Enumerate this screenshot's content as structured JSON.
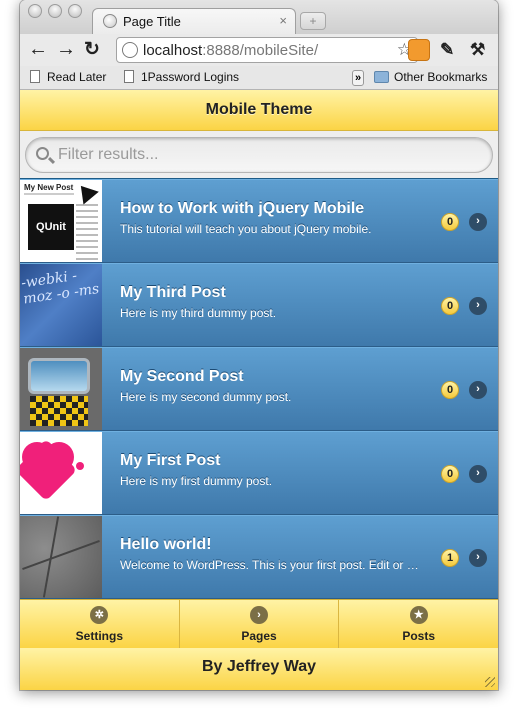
{
  "browser": {
    "tab_title": "Page Title",
    "tab_close": "×",
    "new_tab": "+",
    "url_host": "localhost",
    "url_rest": ":8888/mobileSite/",
    "bookmarks": [
      "Read Later",
      "1Password Logins"
    ],
    "bookmarks_more": "»",
    "other_bookmarks": "Other Bookmarks"
  },
  "page": {
    "header_title": "Mobile Theme",
    "filter_placeholder": "Filter results...",
    "footer": "By Jeffrey Way"
  },
  "posts": [
    {
      "title": "How to Work with jQuery Mobile",
      "excerpt": "This tutorial will teach you about jQuery mobile.",
      "count": "0",
      "thumb_label": "QUnit"
    },
    {
      "title": "My Third Post",
      "excerpt": "Here is my third dummy post.",
      "count": "0",
      "thumb_label": "-webki -moz -o -ms"
    },
    {
      "title": "My Second Post",
      "excerpt": "Here is my second dummy post.",
      "count": "0",
      "thumb_label": ""
    },
    {
      "title": "My First Post",
      "excerpt": "Here is my first dummy post.",
      "count": "0",
      "thumb_label": ""
    },
    {
      "title": "Hello world!",
      "excerpt": "Welcome to WordPress. This is your first post. Edit or delete it, then start blogging!",
      "count": "1",
      "thumb_label": ""
    }
  ],
  "navbar": [
    {
      "label": "Settings",
      "icon": "gear-icon"
    },
    {
      "label": "Pages",
      "icon": "arrow-right-icon"
    },
    {
      "label": "Posts",
      "icon": "star-icon"
    }
  ],
  "colors": {
    "theme_yellow": "#fbd445",
    "list_blue": "#4f8cc0"
  }
}
